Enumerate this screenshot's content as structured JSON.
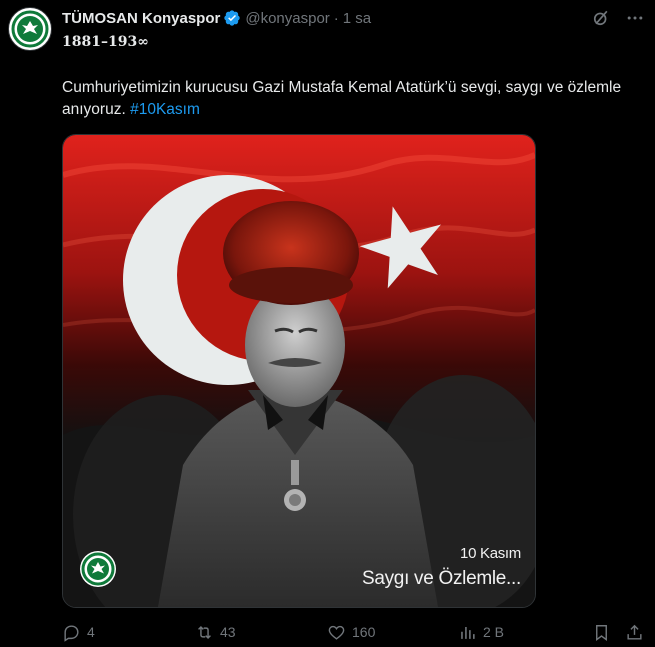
{
  "tweet": {
    "display_name": "TÜMOSAN Konyaspor",
    "handle": "@konyaspor",
    "separator": "·",
    "time": "1 sa",
    "bio_line": "1881–193∞",
    "text_main": "Cumhuriyetimizin kurucusu Gazi Mustafa Kemal Atatürk’ü sevgi, saygı ve özlemle anıyoruz.",
    "hashtag": "#10Kasım"
  },
  "media": {
    "caption_date": "10 Kasım",
    "caption_text": "Saygı ve Özlemle...",
    "logo_text": "KONYASPOR"
  },
  "avatar": {
    "logo_text": "KONYASPOR"
  },
  "actions": {
    "reply_count": "4",
    "retweet_count": "43",
    "like_count": "160",
    "views_count": "2 B"
  },
  "colors": {
    "accent": "#1d9bf0",
    "muted": "#71767b",
    "club_green": "#0f7a3a"
  },
  "icons": [
    "verified-badge-icon",
    "grok-icon",
    "more-icon",
    "reply-icon",
    "retweet-icon",
    "like-icon",
    "views-icon",
    "bookmark-icon",
    "share-icon"
  ]
}
